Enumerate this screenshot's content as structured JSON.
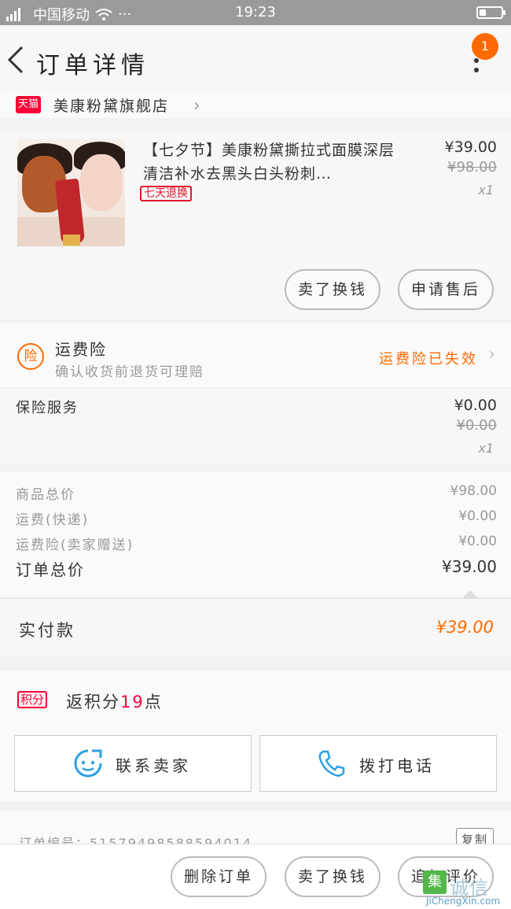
{
  "status_bar": {
    "carrier": "中国移动",
    "dots": "···",
    "time": "19:23"
  },
  "header": {
    "title": "订单详情",
    "badge_count": "1"
  },
  "shop": {
    "tmall_tag": "天猫",
    "name": "美康粉黛旗舰店"
  },
  "product": {
    "title": "【七夕节】美康粉黛撕拉式面膜深层清洁补水去黑头白头粉刺…",
    "tag": "七天退换",
    "price": "¥39.00",
    "original_price": "¥98.00",
    "quantity": "x1",
    "buttons": [
      "卖了换钱",
      "申请售后"
    ]
  },
  "freight_insurance": {
    "icon_text": "险",
    "title": "运费险",
    "subtitle": "确认收货前退货可理赔",
    "status": "运费险已失效"
  },
  "insurance_service": {
    "label": "保险服务",
    "price": "¥0.00",
    "original_price": "¥0.00",
    "quantity": "x1"
  },
  "summary": {
    "rows": [
      {
        "label": "商品总价",
        "value": "¥98.00"
      },
      {
        "label": "运费(快递)",
        "value": "¥0.00"
      },
      {
        "label": "运费险(卖家赠送)",
        "value": "¥0.00"
      }
    ],
    "total_label": "订单总价",
    "total_value": "¥39.00"
  },
  "paid": {
    "label": "实付款",
    "value": "¥39.00"
  },
  "points": {
    "tag": "积分",
    "prefix": "返积分",
    "count": "19",
    "suffix": "点"
  },
  "contact": {
    "seller_label": "联系卖家",
    "phone_label": "拨打电话"
  },
  "order": {
    "number_text": "订单编号：515794985885940​14",
    "copy_label": "复制"
  },
  "bottom_bar": {
    "buttons": [
      "删除订单",
      "卖了换钱",
      "追加评价"
    ]
  },
  "watermark": {
    "icon": "集",
    "cn": "诚信",
    "en": "JiChengXin.com"
  },
  "colors": {
    "accent": "#ff6a00",
    "tmall_red": "#ff0036",
    "status_bar": "#9a9a9a"
  }
}
